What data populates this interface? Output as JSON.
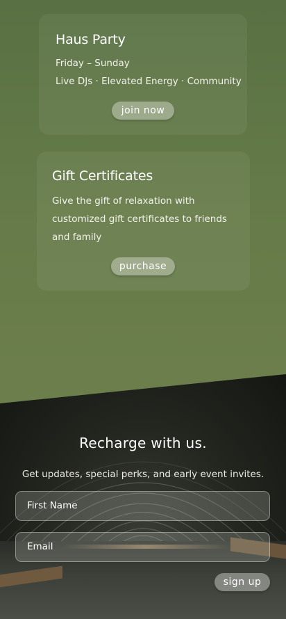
{
  "events": [
    {
      "title": "Haus Party",
      "line1": "Friday – Sunday",
      "line2": "Live DJs · Elevated Energy · Community",
      "button": "join now"
    }
  ],
  "gift": {
    "title": "Gift Certificates",
    "line1": "Give the gift of relaxation with",
    "line2": "customized gift certificates to friends",
    "line3": "and family",
    "button": "purchase"
  },
  "newsletter": {
    "heading": "Recharge with us.",
    "subtext": "Get updates, special perks, and early event invites.",
    "first_name_placeholder": "First Name",
    "email_placeholder": "Email",
    "submit": "sign up"
  },
  "colors": {
    "background_green": "#6a7d49",
    "card": "rgba(255,255,255,0.06)",
    "button": "#a8ae9c"
  }
}
